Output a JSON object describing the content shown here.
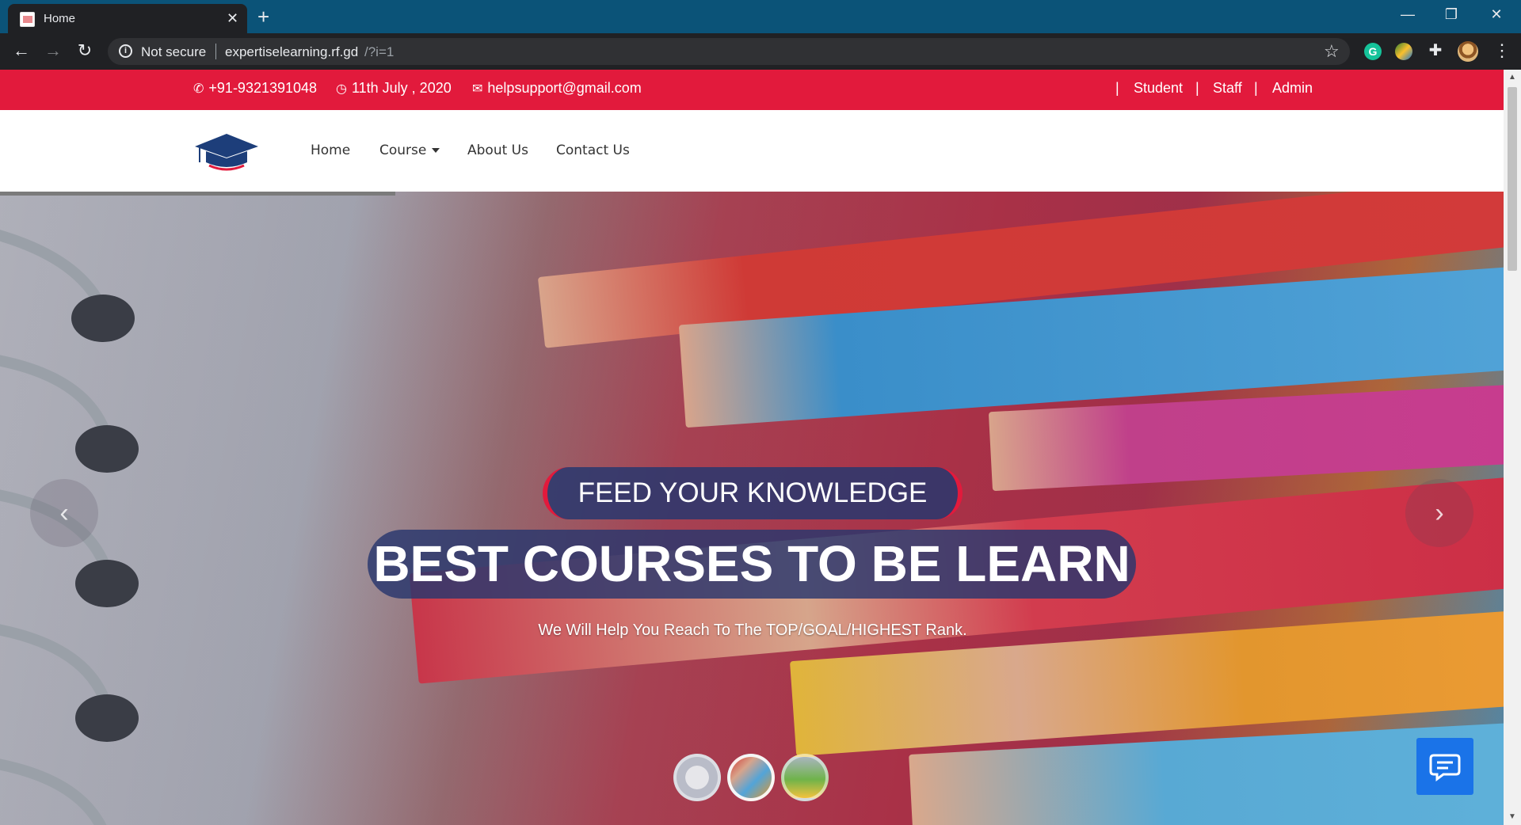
{
  "browser": {
    "tab_title": "Home",
    "not_secure": "Not secure",
    "url_host": "expertiselearning.rf.gd",
    "url_path": "/?i=1",
    "extensions": [
      "grammarly-icon",
      "globe-icon",
      "puzzle-icon",
      "profile-avatar"
    ]
  },
  "topbar": {
    "phone": "+91-9321391048",
    "date": "11th July , 2020",
    "email": "helpsupport@gmail.com",
    "links": [
      "Student",
      "Staff",
      "Admin"
    ],
    "color": "#e21a3c"
  },
  "nav": {
    "items": [
      "Home",
      "Course",
      "About Us",
      "Contact Us"
    ]
  },
  "hero": {
    "kicker": "FEED YOUR KNOWLEDGE",
    "title": "BEST COURSES TO BE LEARN",
    "subtitle": "We Will Help You Reach To The TOP/GOAL/HIGHEST Rank.",
    "slides_count": 3,
    "active_slide": 2
  }
}
